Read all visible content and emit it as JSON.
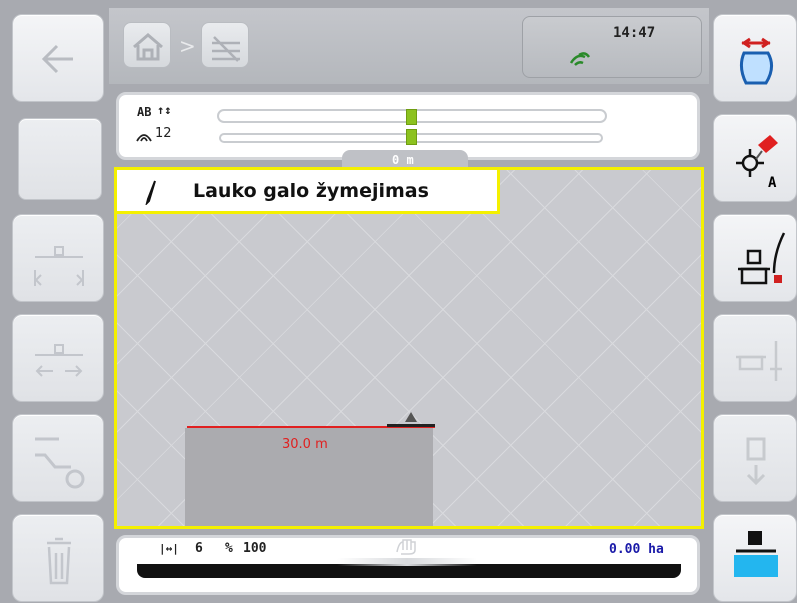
{
  "clock": {
    "time": "14:47"
  },
  "guidance": {
    "mode": "AB",
    "swath_symbol": "↑↕",
    "swath_count": "12",
    "offset": "0 m"
  },
  "title": {
    "text": "Lauko galo žymejimas"
  },
  "map": {
    "distance_label": "30.0 m",
    "headland_color": "#e02020",
    "border_color": "#f4f000"
  },
  "status": {
    "width_icon": "|↔|",
    "width_value": "6",
    "rate_icon": "%",
    "rate_value": "100",
    "area": "0.00 ha",
    "area_color": "#1a1aa8"
  },
  "icons": {
    "left": [
      "back-arrow-icon",
      "blank",
      "headland-width-icon",
      "headland-shift-icon",
      "headland-turn-icon",
      "trash-icon"
    ],
    "right": [
      "field-narrow-icon",
      "set-point-a-icon",
      "record-boundary-icon",
      "headland-distance-icon",
      "tractor-back-icon",
      "section-water-icon"
    ]
  }
}
